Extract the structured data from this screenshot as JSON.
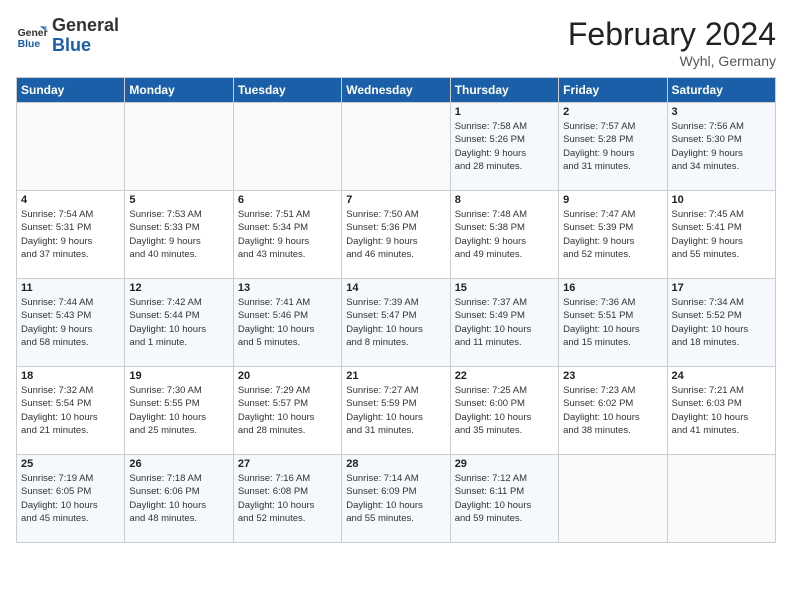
{
  "header": {
    "logo_line1": "General",
    "logo_line2": "Blue",
    "title": "February 2024",
    "subtitle": "Wyhl, Germany"
  },
  "days_of_week": [
    "Sunday",
    "Monday",
    "Tuesday",
    "Wednesday",
    "Thursday",
    "Friday",
    "Saturday"
  ],
  "weeks": [
    [
      {
        "day": "",
        "info": ""
      },
      {
        "day": "",
        "info": ""
      },
      {
        "day": "",
        "info": ""
      },
      {
        "day": "",
        "info": ""
      },
      {
        "day": "1",
        "info": "Sunrise: 7:58 AM\nSunset: 5:26 PM\nDaylight: 9 hours\nand 28 minutes."
      },
      {
        "day": "2",
        "info": "Sunrise: 7:57 AM\nSunset: 5:28 PM\nDaylight: 9 hours\nand 31 minutes."
      },
      {
        "day": "3",
        "info": "Sunrise: 7:56 AM\nSunset: 5:30 PM\nDaylight: 9 hours\nand 34 minutes."
      }
    ],
    [
      {
        "day": "4",
        "info": "Sunrise: 7:54 AM\nSunset: 5:31 PM\nDaylight: 9 hours\nand 37 minutes."
      },
      {
        "day": "5",
        "info": "Sunrise: 7:53 AM\nSunset: 5:33 PM\nDaylight: 9 hours\nand 40 minutes."
      },
      {
        "day": "6",
        "info": "Sunrise: 7:51 AM\nSunset: 5:34 PM\nDaylight: 9 hours\nand 43 minutes."
      },
      {
        "day": "7",
        "info": "Sunrise: 7:50 AM\nSunset: 5:36 PM\nDaylight: 9 hours\nand 46 minutes."
      },
      {
        "day": "8",
        "info": "Sunrise: 7:48 AM\nSunset: 5:38 PM\nDaylight: 9 hours\nand 49 minutes."
      },
      {
        "day": "9",
        "info": "Sunrise: 7:47 AM\nSunset: 5:39 PM\nDaylight: 9 hours\nand 52 minutes."
      },
      {
        "day": "10",
        "info": "Sunrise: 7:45 AM\nSunset: 5:41 PM\nDaylight: 9 hours\nand 55 minutes."
      }
    ],
    [
      {
        "day": "11",
        "info": "Sunrise: 7:44 AM\nSunset: 5:43 PM\nDaylight: 9 hours\nand 58 minutes."
      },
      {
        "day": "12",
        "info": "Sunrise: 7:42 AM\nSunset: 5:44 PM\nDaylight: 10 hours\nand 1 minute."
      },
      {
        "day": "13",
        "info": "Sunrise: 7:41 AM\nSunset: 5:46 PM\nDaylight: 10 hours\nand 5 minutes."
      },
      {
        "day": "14",
        "info": "Sunrise: 7:39 AM\nSunset: 5:47 PM\nDaylight: 10 hours\nand 8 minutes."
      },
      {
        "day": "15",
        "info": "Sunrise: 7:37 AM\nSunset: 5:49 PM\nDaylight: 10 hours\nand 11 minutes."
      },
      {
        "day": "16",
        "info": "Sunrise: 7:36 AM\nSunset: 5:51 PM\nDaylight: 10 hours\nand 15 minutes."
      },
      {
        "day": "17",
        "info": "Sunrise: 7:34 AM\nSunset: 5:52 PM\nDaylight: 10 hours\nand 18 minutes."
      }
    ],
    [
      {
        "day": "18",
        "info": "Sunrise: 7:32 AM\nSunset: 5:54 PM\nDaylight: 10 hours\nand 21 minutes."
      },
      {
        "day": "19",
        "info": "Sunrise: 7:30 AM\nSunset: 5:55 PM\nDaylight: 10 hours\nand 25 minutes."
      },
      {
        "day": "20",
        "info": "Sunrise: 7:29 AM\nSunset: 5:57 PM\nDaylight: 10 hours\nand 28 minutes."
      },
      {
        "day": "21",
        "info": "Sunrise: 7:27 AM\nSunset: 5:59 PM\nDaylight: 10 hours\nand 31 minutes."
      },
      {
        "day": "22",
        "info": "Sunrise: 7:25 AM\nSunset: 6:00 PM\nDaylight: 10 hours\nand 35 minutes."
      },
      {
        "day": "23",
        "info": "Sunrise: 7:23 AM\nSunset: 6:02 PM\nDaylight: 10 hours\nand 38 minutes."
      },
      {
        "day": "24",
        "info": "Sunrise: 7:21 AM\nSunset: 6:03 PM\nDaylight: 10 hours\nand 41 minutes."
      }
    ],
    [
      {
        "day": "25",
        "info": "Sunrise: 7:19 AM\nSunset: 6:05 PM\nDaylight: 10 hours\nand 45 minutes."
      },
      {
        "day": "26",
        "info": "Sunrise: 7:18 AM\nSunset: 6:06 PM\nDaylight: 10 hours\nand 48 minutes."
      },
      {
        "day": "27",
        "info": "Sunrise: 7:16 AM\nSunset: 6:08 PM\nDaylight: 10 hours\nand 52 minutes."
      },
      {
        "day": "28",
        "info": "Sunrise: 7:14 AM\nSunset: 6:09 PM\nDaylight: 10 hours\nand 55 minutes."
      },
      {
        "day": "29",
        "info": "Sunrise: 7:12 AM\nSunset: 6:11 PM\nDaylight: 10 hours\nand 59 minutes."
      },
      {
        "day": "",
        "info": ""
      },
      {
        "day": "",
        "info": ""
      }
    ]
  ]
}
